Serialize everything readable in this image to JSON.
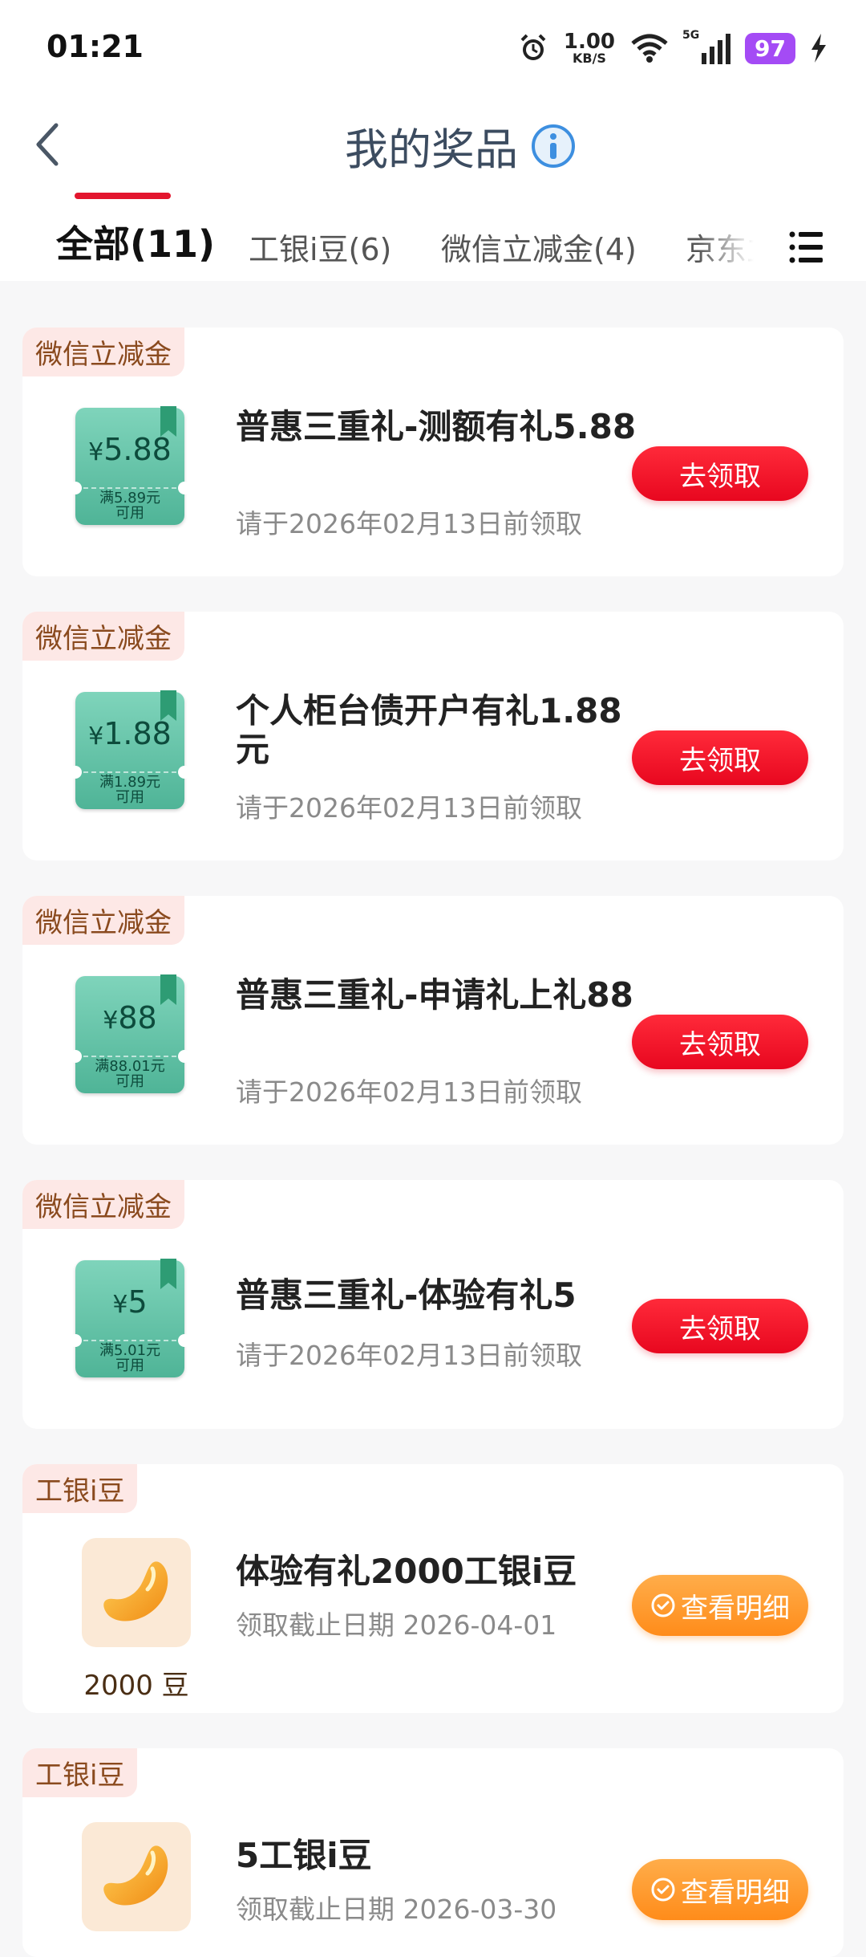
{
  "status_bar": {
    "time": "01:21",
    "net_speed_value": "1.00",
    "net_speed_unit": "KB/S",
    "signal_label": "5G",
    "battery": "97"
  },
  "header": {
    "title": "我的奖品"
  },
  "tabs": [
    {
      "label": "全部(11)",
      "active": true
    },
    {
      "label": "工银i豆(6)",
      "active": false
    },
    {
      "label": "微信立减金(4)",
      "active": false
    },
    {
      "label": "京东立",
      "active": false
    }
  ],
  "cards": [
    {
      "tag": "微信立减金",
      "coupon_currency": "¥",
      "coupon_value": "5.88",
      "coupon_cond_1": "满5.89元",
      "coupon_cond_2": "可用",
      "name": "普惠三重礼-测额有礼5.88",
      "sub": "请于2026年02月13日前领取",
      "button": "去领取"
    },
    {
      "tag": "微信立减金",
      "coupon_currency": "¥",
      "coupon_value": "1.88",
      "coupon_cond_1": "满1.89元",
      "coupon_cond_2": "可用",
      "name": "个人柜台债开户有礼1.88元",
      "sub": "请于2026年02月13日前领取",
      "button": "去领取"
    },
    {
      "tag": "微信立减金",
      "coupon_currency": "¥",
      "coupon_value": "88",
      "coupon_cond_1": "满88.01元",
      "coupon_cond_2": "可用",
      "name": "普惠三重礼-申请礼上礼88",
      "sub": "请于2026年02月13日前领取",
      "button": "去领取"
    },
    {
      "tag": "微信立减金",
      "coupon_currency": "¥",
      "coupon_value": "5",
      "coupon_cond_1": "满5.01元",
      "coupon_cond_2": "可用",
      "name": "普惠三重礼-体验有礼5",
      "sub": "请于2026年02月13日前领取",
      "button": "去领取"
    },
    {
      "tag": "工银i豆",
      "amount": "2000 豆",
      "name": "体验有礼2000工银i豆",
      "sub": "领取截止日期 2026-04-01",
      "button": "查看明细"
    },
    {
      "tag": "工银i豆",
      "name": "5工银i豆",
      "sub": "领取截止日期 2026-03-30",
      "button": "查看明细"
    }
  ],
  "colors": {
    "accent_red": "#e3162e",
    "detail_orange": "#ff9a2e",
    "coupon_green": "#5cbf9f",
    "title_blue": "#3c4c60",
    "info_blue": "#3d8fe0"
  }
}
